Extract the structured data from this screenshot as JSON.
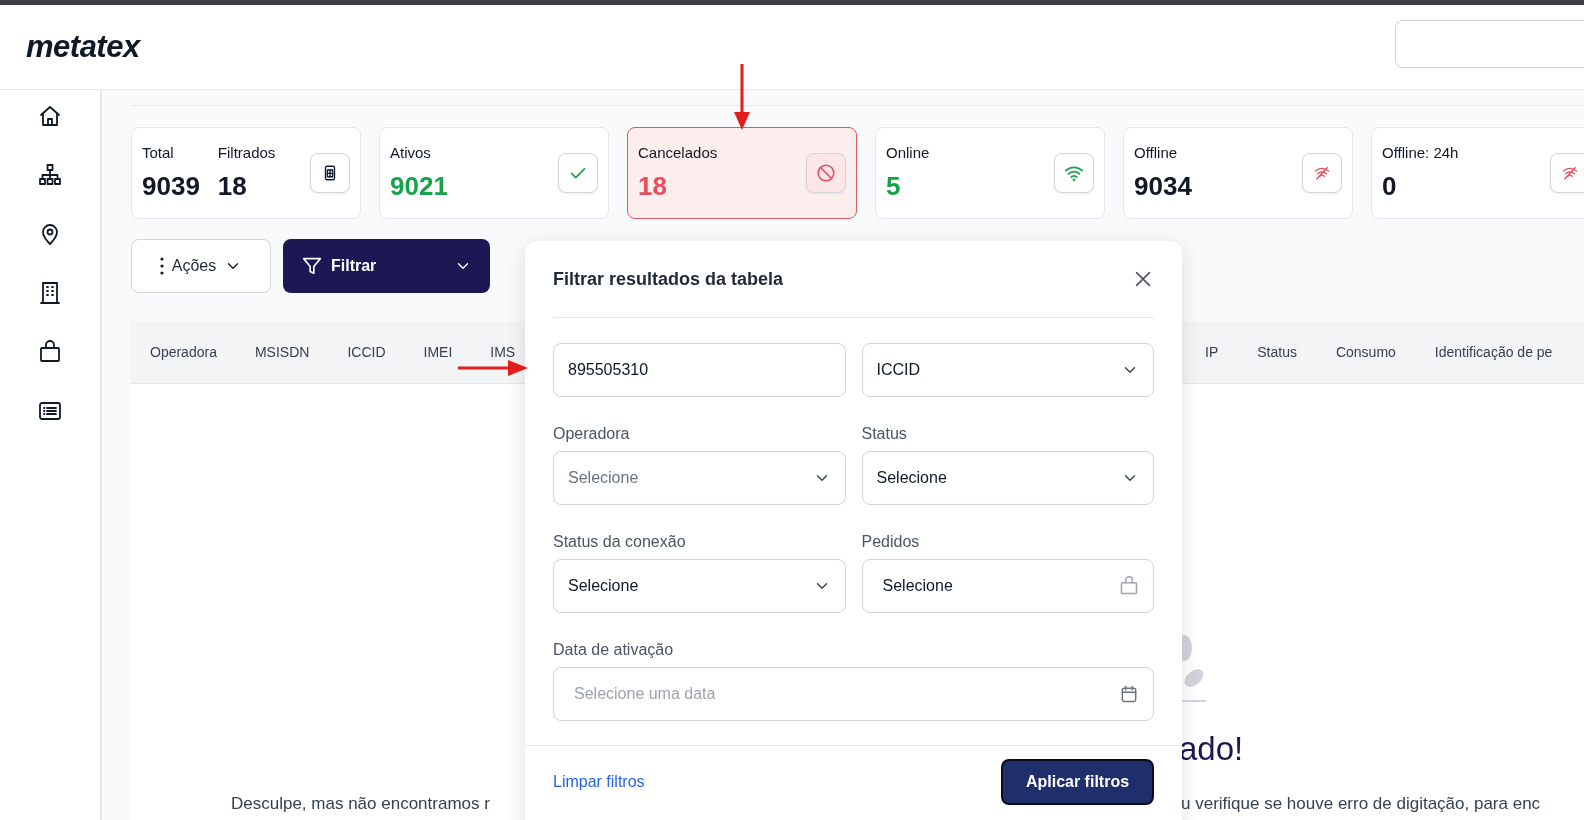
{
  "header": {
    "logo": "metatex"
  },
  "stats": [
    {
      "kind": "double",
      "label": "Total",
      "value": "9039",
      "label_2": "Filtrados",
      "value_2": "18",
      "selected": false,
      "color": "#111827"
    },
    {
      "kind": "single",
      "label": "Ativos",
      "value": "9021",
      "selected": false,
      "color": "#16a34a"
    },
    {
      "kind": "single",
      "label": "Cancelados",
      "value": "18",
      "selected": true,
      "color": "#e5505f"
    },
    {
      "kind": "single",
      "label": "Online",
      "value": "5",
      "selected": false,
      "color": "#16a34a"
    },
    {
      "kind": "single",
      "label": "Offline",
      "value": "9034",
      "selected": false,
      "color": "#111827"
    },
    {
      "kind": "single",
      "label": "Offline: 24h",
      "value": "0",
      "selected": false,
      "color": "#111827"
    }
  ],
  "toolbar": {
    "actions_button": "Ações",
    "filter_button": "Filtrar"
  },
  "table": {
    "columns_left": [
      "Operadora",
      "MSISDN",
      "ICCID",
      "IMEI",
      "IMS"
    ],
    "columns_right": [
      "IP",
      "Status",
      "Consumo",
      "Identificação de pe"
    ]
  },
  "empty_state": {
    "title": "ado!",
    "message_left": "Desculpe, mas não encontramos r",
    "message_right": "u verifique se houve erro de digitação, para enc"
  },
  "filter_panel": {
    "title": "Filtrar resultados da tabela",
    "search": {
      "value": "895505310"
    },
    "search_by": {
      "value": "ICCID"
    },
    "fields": [
      {
        "label": "Operadora",
        "kind": "select",
        "placeholder": "Selecione"
      },
      {
        "label": "Status",
        "kind": "select",
        "value": "Selecione"
      },
      {
        "label": "Status da conexão",
        "kind": "select",
        "value": "Selecione"
      },
      {
        "label": "Pedidos",
        "kind": "picker",
        "value": "Selecione"
      },
      {
        "label": "Data de ativação",
        "kind": "date",
        "placeholder": "Selecione uma data"
      }
    ],
    "clear_link": "Limpar filtros",
    "apply_button": "Aplicar filtros"
  }
}
